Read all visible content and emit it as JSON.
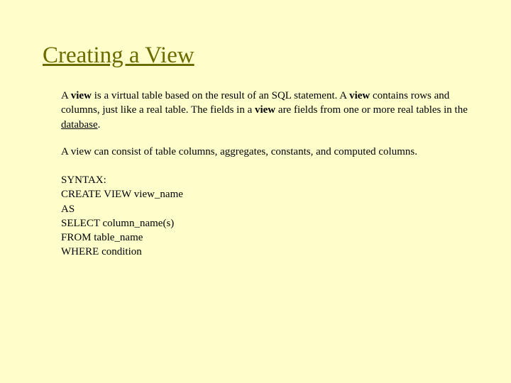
{
  "title": "Creating a View",
  "para1_lead": "A ",
  "para1_bold1": "view",
  "para1_mid1": " is a virtual table based on the result of an SQL statement. A ",
  "para1_bold2": "view",
  "para1_mid2": " contains rows and columns, just like a real table. The fields in a ",
  "para1_bold3": "view",
  "para1_mid3": " are fields from one or more real tables in the ",
  "para1_under": "database",
  "para1_end": ".",
  "para2": "A view can consist of table columns, aggregates, constants, and computed columns.",
  "syntax": {
    "l1": "SYNTAX:",
    "l2": "CREATE VIEW view_name",
    "l3": "AS",
    "l4": "SELECT column_name(s)",
    "l5": "FROM table_name",
    "l6": "WHERE condition"
  }
}
